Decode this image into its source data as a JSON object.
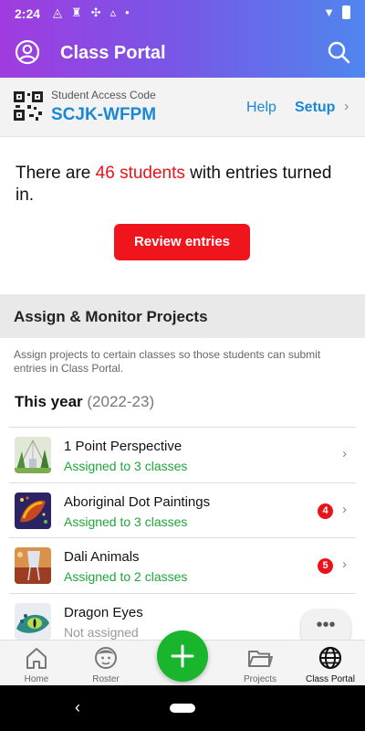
{
  "status_bar": {
    "time": "2:24"
  },
  "app": {
    "title": "Class Portal"
  },
  "access": {
    "caption": "Student Access Code",
    "code": "SCJK-WFPM",
    "help_label": "Help",
    "setup_label": "Setup"
  },
  "entries": {
    "prefix": "There are ",
    "highlight": "46 students",
    "suffix": " with entries turned in.",
    "button_label": "Review entries"
  },
  "projects": {
    "section_title": "Assign & Monitor Projects",
    "description": "Assign projects to certain classes so those students can submit entries in Class Portal.",
    "year_label": "This year",
    "year_range": "(2022-23)",
    "items": [
      {
        "name": "1 Point Perspective",
        "status": "Assigned to 3 classes",
        "badge": ""
      },
      {
        "name": "Aboriginal Dot Paintings",
        "status": "Assigned to 3 classes",
        "badge": "4"
      },
      {
        "name": "Dali Animals",
        "status": "Assigned to 2 classes",
        "badge": "5"
      },
      {
        "name": "Dragon Eyes",
        "status": "Not assigned",
        "badge": ""
      }
    ]
  },
  "bottom_nav": {
    "home": "Home",
    "roster": "Roster",
    "projects": "Projects",
    "class_portal": "Class Portal"
  },
  "colors": {
    "accent_blue": "#1a88d6",
    "alert_red": "#e8141a",
    "success_green": "#1fa63a",
    "fab_green": "#19b52c"
  }
}
